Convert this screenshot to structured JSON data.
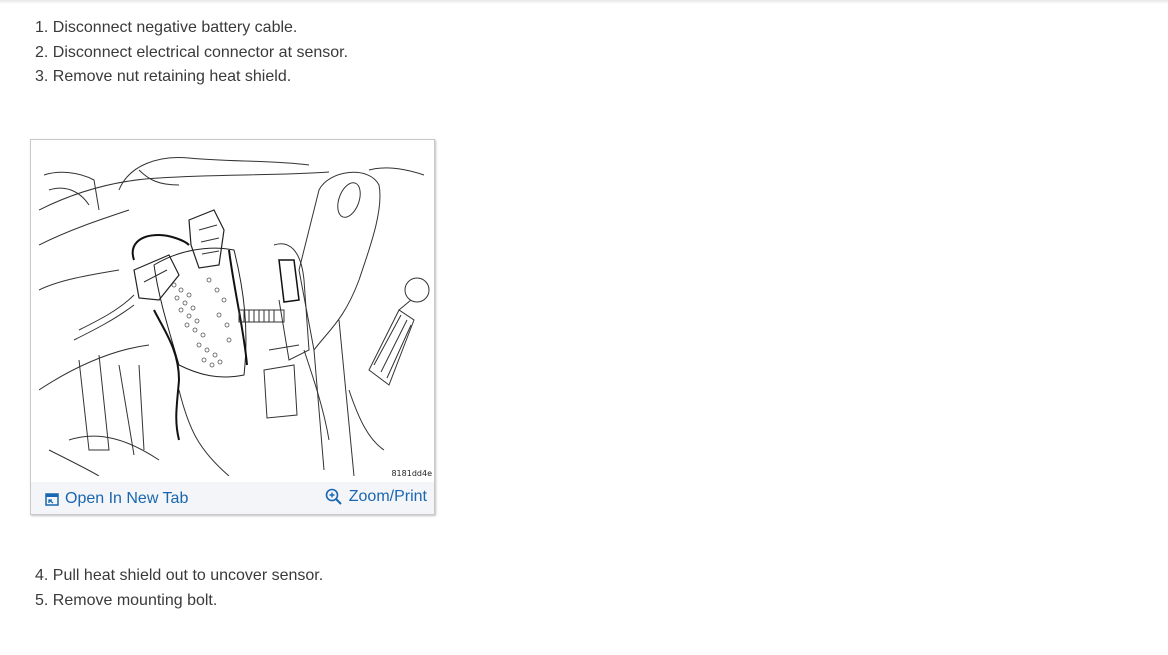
{
  "steps_top": [
    "1. Disconnect negative battery cable.",
    "2. Disconnect electrical connector at sensor.",
    "3. Remove nut retaining heat shield."
  ],
  "figure": {
    "code": "8181dd4e",
    "open_tab_label": "Open In New Tab",
    "open_tab_icon": "open-in-new-tab-icon",
    "zoom_label": "Zoom/Print",
    "zoom_icon": "zoom-in-icon"
  },
  "steps_bottom": [
    "4. Pull heat shield out to uncover sensor.",
    "5. Remove mounting bolt."
  ],
  "colors": {
    "link": "#1a66b0",
    "text": "#3a3a3a",
    "toolbar_bg": "#f3f5f8"
  }
}
